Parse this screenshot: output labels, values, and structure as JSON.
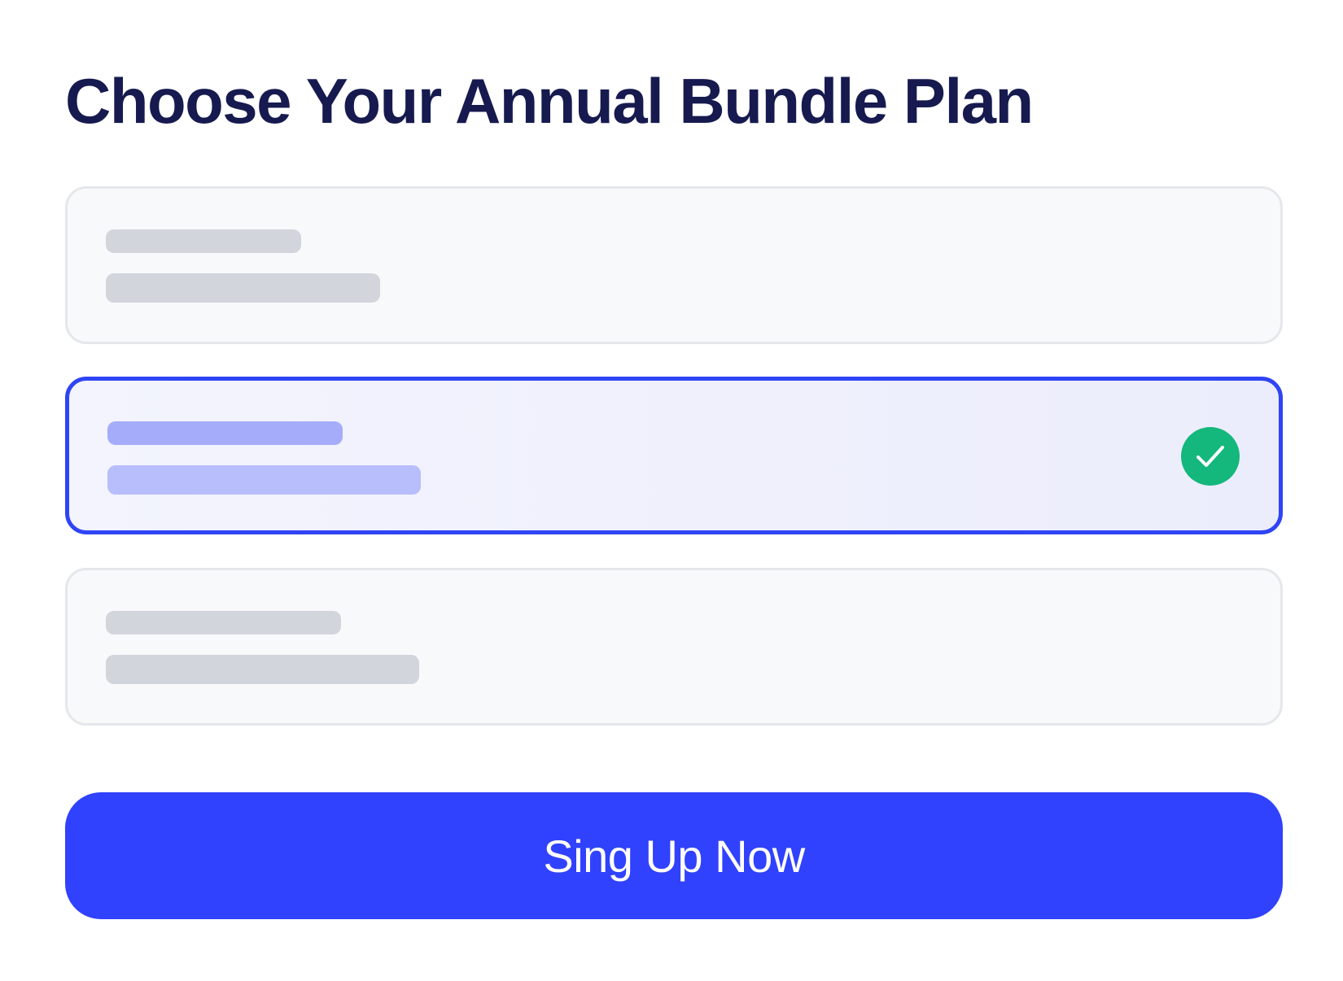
{
  "page": {
    "title": "Choose Your Annual Bundle Plan"
  },
  "plans": [
    {
      "selected": false
    },
    {
      "selected": true,
      "badge_icon": "check-icon"
    },
    {
      "selected": false
    }
  ],
  "cta": {
    "label": "Sing Up Now"
  },
  "colors": {
    "title": "#161a4f",
    "accent": "#3042fd",
    "selected_border": "#2f44f5",
    "check_badge": "#14b77c",
    "placeholder_bar": "#d2d5dc",
    "selected_bar": "#a5acfa"
  }
}
